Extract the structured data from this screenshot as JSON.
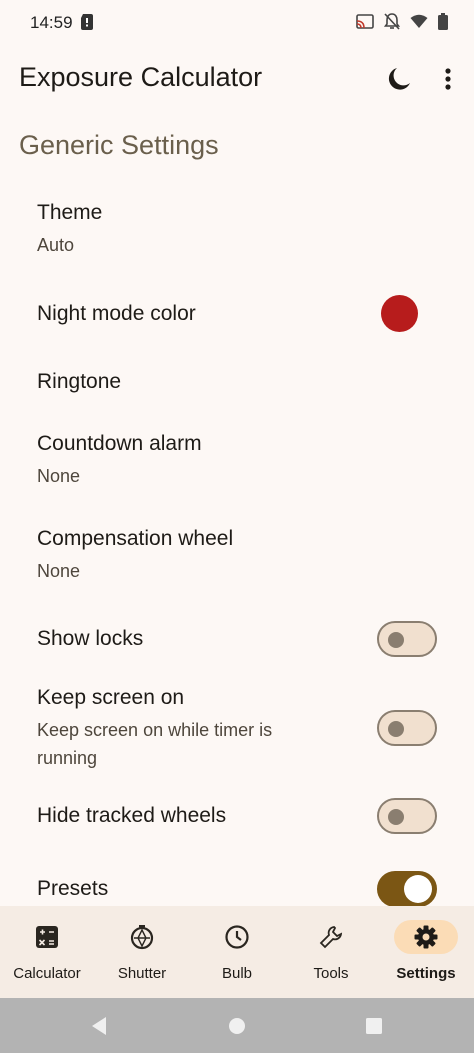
{
  "status_bar": {
    "time": "14:59"
  },
  "app_bar": {
    "title": "Exposure Calculator"
  },
  "section": {
    "title": "Generic Settings"
  },
  "settings": {
    "theme": {
      "title": "Theme",
      "summary": "Auto"
    },
    "night_mode_color": {
      "title": "Night mode color",
      "color": "#b71c1c"
    },
    "ringtone": {
      "title": "Ringtone"
    },
    "countdown_alarm": {
      "title": "Countdown alarm",
      "summary": "None"
    },
    "compensation_wheel": {
      "title": "Compensation wheel",
      "summary": "None"
    },
    "show_locks": {
      "title": "Show locks",
      "enabled": false
    },
    "keep_screen_on": {
      "title": "Keep screen on",
      "summary": "Keep screen on while timer is running",
      "enabled": false
    },
    "hide_tracked_wheels": {
      "title": "Hide tracked wheels",
      "enabled": false
    },
    "presets": {
      "title": "Presets",
      "enabled": true
    }
  },
  "bottom_nav": {
    "items": [
      {
        "label": "Calculator",
        "icon": "calculator-icon"
      },
      {
        "label": "Shutter",
        "icon": "shutter-icon"
      },
      {
        "label": "Bulb",
        "icon": "clock-icon"
      },
      {
        "label": "Tools",
        "icon": "wrench-icon"
      },
      {
        "label": "Settings",
        "icon": "gear-icon",
        "active": true
      }
    ]
  },
  "colors": {
    "accent": "#7b5614",
    "active_pill": "#fbdcb6",
    "section_title": "#6a5f4c"
  }
}
